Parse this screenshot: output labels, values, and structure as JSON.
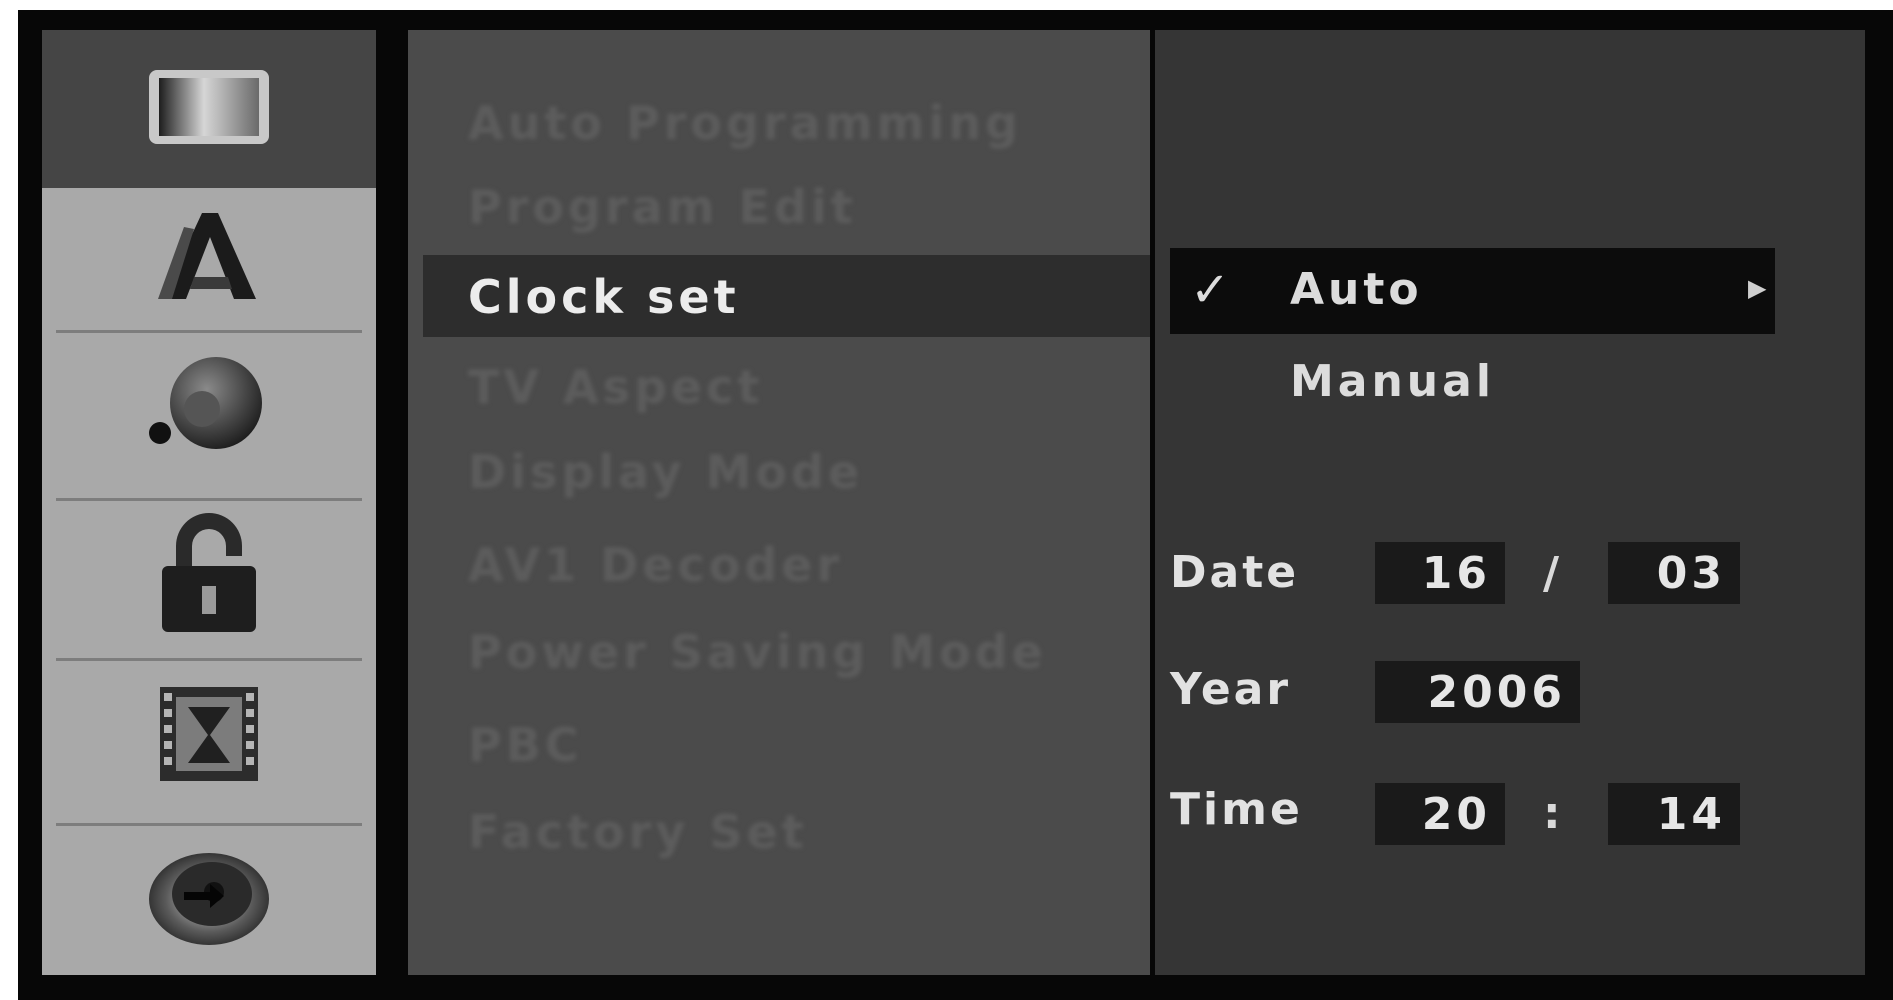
{
  "sidebar": {
    "icons": [
      "display-icon",
      "language-icon",
      "audio-icon",
      "lock-icon",
      "recording-icon",
      "disc-icon"
    ],
    "active_index": 0
  },
  "menu": {
    "items": [
      {
        "label": "Auto Programming",
        "selected": false
      },
      {
        "label": "Program Edit",
        "selected": false
      },
      {
        "label": "Clock set",
        "selected": true
      },
      {
        "label": "TV Aspect",
        "selected": false
      },
      {
        "label": "Display Mode",
        "selected": false
      },
      {
        "label": "AV1 Decoder",
        "selected": false
      },
      {
        "label": "Power Saving Mode",
        "selected": false
      },
      {
        "label": "PBC",
        "selected": false
      },
      {
        "label": "Factory Set",
        "selected": false
      }
    ]
  },
  "clock": {
    "options": {
      "auto": {
        "label": "Auto",
        "checked": true,
        "check_mark": "✓",
        "arrow": "▶"
      },
      "manual": {
        "label": "Manual",
        "checked": false
      }
    },
    "date": {
      "label": "Date",
      "day": "16",
      "separator": "/",
      "month": "03"
    },
    "year": {
      "label": "Year",
      "value": "2006"
    },
    "time": {
      "label": "Time",
      "hour": "20",
      "separator": ":",
      "minute": "14"
    }
  },
  "colors": {
    "frame": "#070707",
    "icon_column": "#a9a9a9",
    "menu_panel": "#4b4b4b",
    "right_panel": "#353535",
    "selected_text": "#ececec"
  }
}
